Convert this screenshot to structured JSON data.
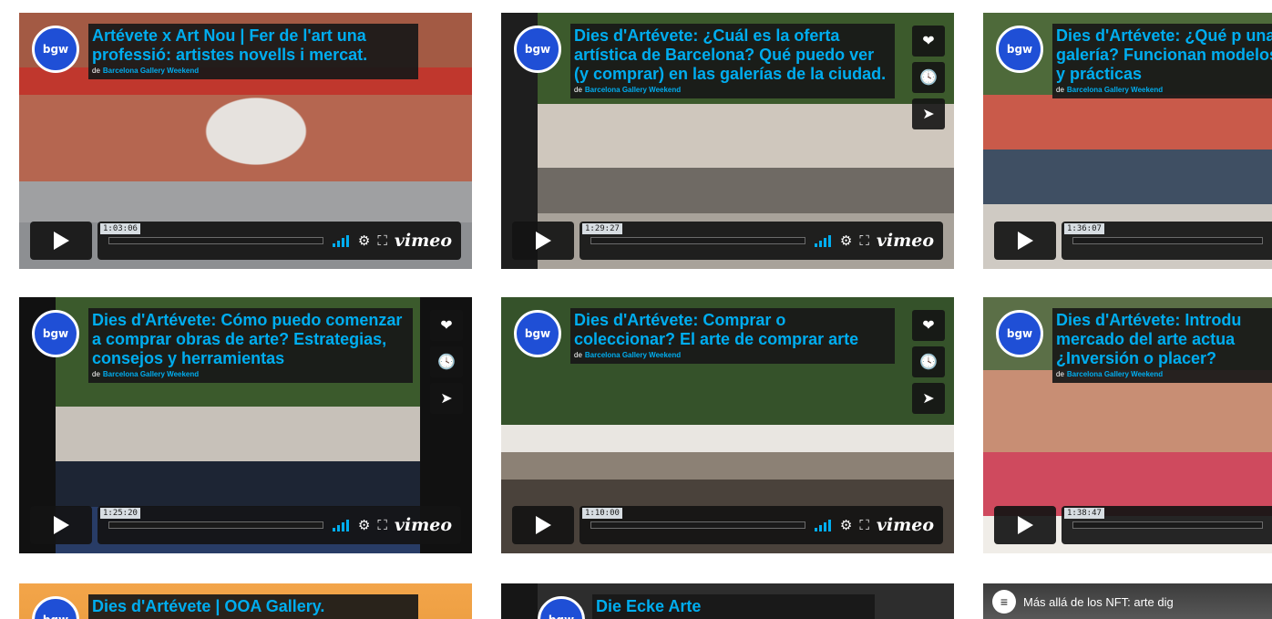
{
  "logo_text": "bgw",
  "byline_prefix": "de",
  "owner": "Barcelona Gallery Weekend",
  "vimeo_label": "vimeo",
  "icons": {
    "like": "heart-icon",
    "watch_later": "clock-icon",
    "share": "paper-plane-icon",
    "play": "play-icon",
    "volume": "volume-icon",
    "settings": "gear-icon",
    "fullscreen": "fullscreen-icon"
  },
  "colors": {
    "accent": "#00adef",
    "panel": "#181818",
    "logo_bg": "#1f4fd6"
  },
  "videos": [
    {
      "title": "Artévete x Art Nou | Fer de l'art una professió: artistes novells i mercat.",
      "duration": "1:03:06",
      "progress": 0
    },
    {
      "title": "Dies d'Artévete: ¿Cuál es la oferta artística de Barcelona? Qué puedo ver (y comprar) en las galerías de la ciudad.",
      "duration": "1:29:27",
      "progress": 0
    },
    {
      "title": "Dies d'Artévete: ¿Qué p una galería? Funcionan modelos y prácticas",
      "duration": "1:36:07",
      "progress": 0
    },
    {
      "title": "Dies d'Artévete: Cómo puedo comenzar a comprar obras de arte? Estrategias, consejos y herramientas",
      "duration": "1:25:20",
      "progress": 0
    },
    {
      "title": "Dies d'Artévete: Comprar o coleccionar? El arte de comprar arte",
      "duration": "1:10:00",
      "progress": 0
    },
    {
      "title": "Dies d'Artévete: Introdu mercado del arte actua ¿Inversión o placer?",
      "duration": "1:38:47",
      "progress": 0
    },
    {
      "title": "Dies d'Artévete | OOA Gallery.",
      "duration": "",
      "progress": 0
    },
    {
      "title": "Die Ecke Arte",
      "duration": "",
      "progress": 0
    },
    {
      "title": "Más allá de los NFT: arte dig",
      "duration": "",
      "progress": 0
    }
  ]
}
